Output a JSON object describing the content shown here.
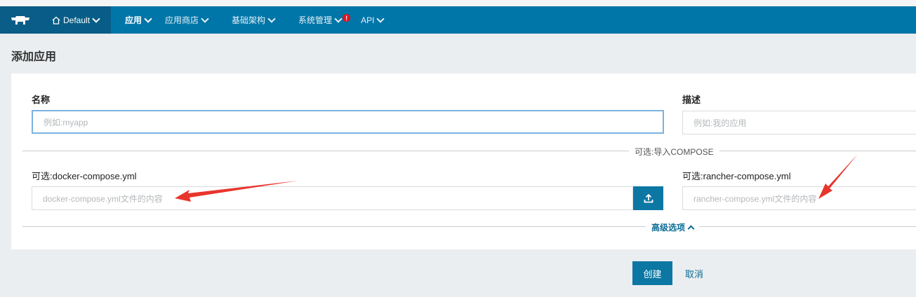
{
  "navbar": {
    "environment": "Default",
    "items": [
      {
        "label": "应用",
        "active": true
      },
      {
        "label": "应用商店"
      },
      {
        "label": "基础架构"
      },
      {
        "label": "系统管理",
        "alert": "!"
      },
      {
        "label": "API"
      }
    ]
  },
  "page": {
    "title": "添加应用"
  },
  "form": {
    "name_label": "名称",
    "name_placeholder": "例如:myapp",
    "desc_label": "描述",
    "desc_placeholder": "例如:我的应用",
    "import_divider": "可选:导入COMPOSE",
    "docker_label": "可选:docker-compose.yml",
    "docker_placeholder": "docker-compose.yml文件的内容",
    "rancher_label": "可选:rancher-compose.yml",
    "rancher_placeholder": "rancher-compose.yml文件的内容",
    "advanced": "高级选项"
  },
  "actions": {
    "create": "创建",
    "cancel": "取消"
  },
  "icons": {
    "logo": "cow-logo-icon",
    "home": "home-icon",
    "upload": "upload-icon"
  },
  "colors": {
    "navbar": "#0075a8",
    "primary": "#0c77a3",
    "annotation_arrow": "#e8352c"
  }
}
